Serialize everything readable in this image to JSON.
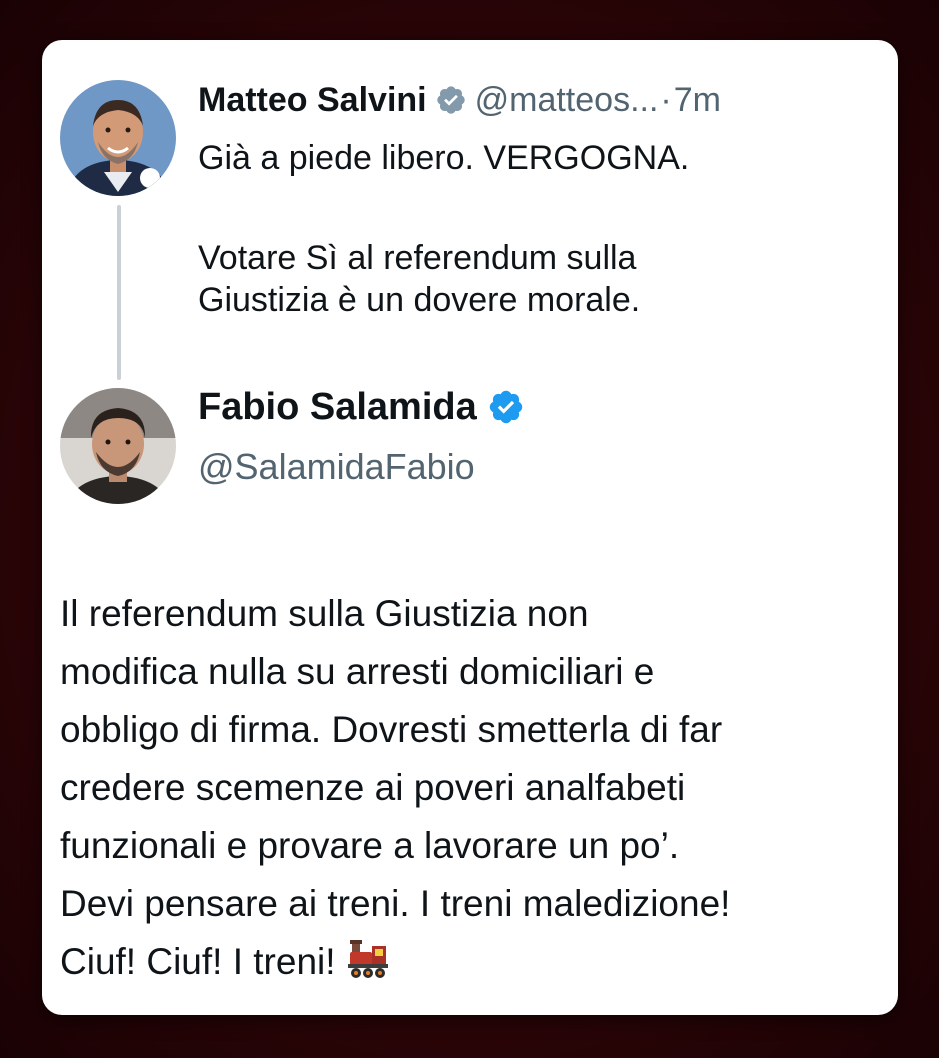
{
  "quoted_tweet": {
    "author_name": "Matteo Salvini",
    "handle": "@matteos...",
    "separator": "·",
    "time": "7m",
    "verified_badge_icon": "gray-verified-badge-icon",
    "text_lines": [
      "Già a piede libero. VERGOGNA.",
      "Votare Sì al referendum sulla",
      "Giustizia è un dovere morale."
    ]
  },
  "reply": {
    "author_name": "Fabio Salamida",
    "handle": "@SalamidaFabio",
    "verified_badge_icon": "blue-verified-badge-icon",
    "text_lines": [
      "Il referendum sulla Giustizia non",
      "modifica nulla su arresti domiciliari e",
      "obbligo di firma. Dovresti smetterla di far",
      "credere scemenze ai poveri analfabeti",
      "funzionali e provare a lavorare un po’.",
      "Devi pensare ai treni. I treni maledizione!",
      "Ciuf! Ciuf! I treni!"
    ],
    "trailing_emoji_icon": "steam-locomotive-icon"
  },
  "colors": {
    "background": "#2e0508",
    "card": "#ffffff",
    "text_primary": "#0f1419",
    "text_secondary": "#536471",
    "verified_blue": "#1d9bf0",
    "verified_gray": "#829aab",
    "thread_line": "#c9d0d6"
  }
}
